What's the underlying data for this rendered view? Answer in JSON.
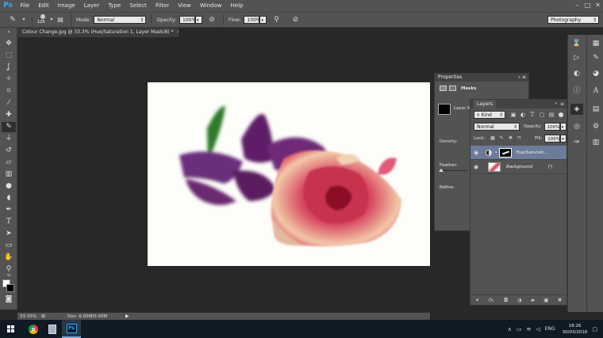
{
  "app": {
    "logo_text": "Ps"
  },
  "menu": [
    "File",
    "Edit",
    "Image",
    "Layer",
    "Type",
    "Select",
    "Filter",
    "View",
    "Window",
    "Help"
  ],
  "window_controls": [
    "–",
    "□",
    "✕"
  ],
  "options_bar": {
    "brush_size": "125",
    "mode_label": "Mode:",
    "mode_value": "Normal",
    "opacity_label": "Opacity:",
    "opacity_value": "100%",
    "flow_label": "Flow:",
    "flow_value": "100%",
    "workspace_value": "Photography"
  },
  "document_tab": {
    "title": "Colour Change.jpg @ 33.3% (Hue/Saturation 1, Layer Mask/8) *",
    "close": "×"
  },
  "status_bar": {
    "zoom": "33.33%",
    "doc_info": "Doc: 6.00M/0.00M"
  },
  "properties_panel": {
    "title": "Properties",
    "masks_label": "Masks",
    "layer_mask_label": "Layer M",
    "density_label": "Density:",
    "feather_label": "Feather:",
    "refine_label": "Refine:"
  },
  "layers_panel": {
    "title": "Layers",
    "filter_kind": "Kind",
    "blend_mode": "Normal",
    "opacity_label": "Opacity:",
    "opacity_value": "100%",
    "lock_label": "Lock:",
    "fill_label": "Fill:",
    "fill_value": "100%",
    "layers": [
      {
        "name": "Hue/Saturati...",
        "selected": true
      },
      {
        "name": "Background",
        "selected": false
      }
    ],
    "footer_fx": "fx."
  },
  "taskbar": {
    "language": "ENG",
    "time": "18:26",
    "date": "30/03/2016"
  },
  "colors": {
    "ui_panel": "#535353",
    "workspace_bg": "#282828",
    "selected_layer": "#6b7b99",
    "ps_blue": "#31a8ff",
    "taskbar": "#101a24"
  }
}
